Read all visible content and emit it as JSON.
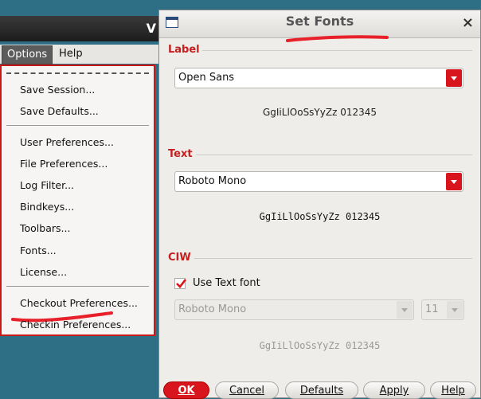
{
  "background_window": {
    "title_fragment": "V",
    "menubar": {
      "options": "Options",
      "help": "Help"
    },
    "options_menu": {
      "items": [
        "Save Session...",
        "Save Defaults...",
        "User Preferences...",
        "File Preferences...",
        "Log Filter...",
        "Bindkeys...",
        "Toolbars...",
        "Fonts...",
        "License...",
        "Checkout Preferences...",
        "Checkin Preferences..."
      ]
    }
  },
  "dialog": {
    "title": "Set Fonts",
    "close_icon": "close-icon",
    "label_section": {
      "heading": "Label",
      "font": "Open Sans",
      "preview": "GgIiLlOoSsYyZz 012345"
    },
    "text_section": {
      "heading": "Text",
      "font": "Roboto Mono",
      "preview": "GgIiLlOoSsYyZz 012345"
    },
    "ciw_section": {
      "heading": "CIW",
      "use_text_font_label": "Use Text font",
      "use_text_font_checked": true,
      "font": "Roboto Mono",
      "size": "11",
      "preview": "GgIiLlOoSsYyZz 012345"
    },
    "buttons": {
      "ok": "OK",
      "cancel": "Cancel",
      "defaults": "Defaults",
      "apply": "Apply",
      "help": "Help"
    }
  },
  "colors": {
    "accent_red": "#d8141c",
    "annotation_red": "#e8202a",
    "desktop": "#2f6f86"
  }
}
